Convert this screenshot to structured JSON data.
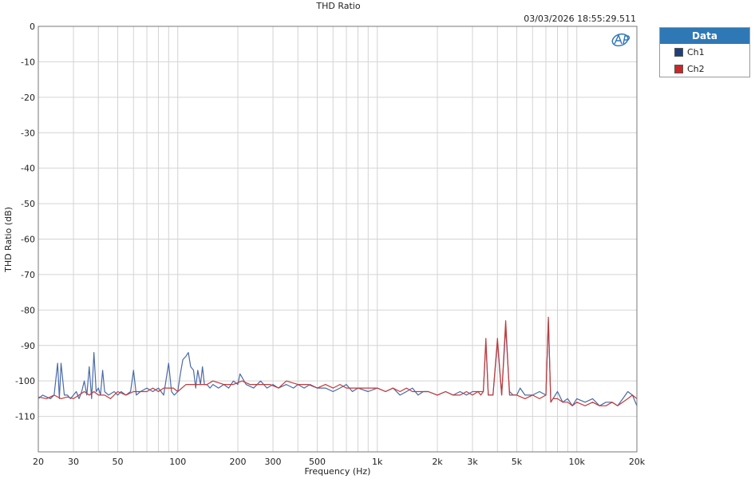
{
  "chart_data": {
    "type": "line",
    "title": "THD Ratio",
    "timestamp": "03/03/2026 18:55:29.511",
    "xlabel": "Frequency (Hz)",
    "ylabel": "THD Ratio (dB)",
    "xscale": "log",
    "xlim": [
      20,
      20000
    ],
    "ylim": [
      -120,
      0
    ],
    "grid": true,
    "x_ticks": [
      {
        "value": 20,
        "label": "20"
      },
      {
        "value": 30,
        "label": "30"
      },
      {
        "value": 50,
        "label": "50"
      },
      {
        "value": 100,
        "label": "100"
      },
      {
        "value": 200,
        "label": "200"
      },
      {
        "value": 300,
        "label": "300"
      },
      {
        "value": 500,
        "label": "500"
      },
      {
        "value": 1000,
        "label": "1k"
      },
      {
        "value": 2000,
        "label": "2k"
      },
      {
        "value": 3000,
        "label": "3k"
      },
      {
        "value": 5000,
        "label": "5k"
      },
      {
        "value": 10000,
        "label": "10k"
      },
      {
        "value": 20000,
        "label": "20k"
      }
    ],
    "y_ticks": [
      {
        "value": 0,
        "label": "0"
      },
      {
        "value": -10,
        "label": "-10"
      },
      {
        "value": -20,
        "label": "-20"
      },
      {
        "value": -30,
        "label": "-30"
      },
      {
        "value": -40,
        "label": "-40"
      },
      {
        "value": -50,
        "label": "-50"
      },
      {
        "value": -60,
        "label": "-60"
      },
      {
        "value": -70,
        "label": "-70"
      },
      {
        "value": -80,
        "label": "-80"
      },
      {
        "value": -90,
        "label": "-90"
      },
      {
        "value": -100,
        "label": "-100"
      },
      {
        "value": -110,
        "label": "-110"
      }
    ],
    "legend": {
      "title": "Data",
      "position": "right"
    },
    "series": [
      {
        "name": "Ch1",
        "color": "#4a6aa8",
        "points": [
          [
            20,
            -105
          ],
          [
            21,
            -104
          ],
          [
            22,
            -104.5
          ],
          [
            23,
            -105
          ],
          [
            24,
            -104
          ],
          [
            25,
            -95
          ],
          [
            25.5,
            -105
          ],
          [
            26,
            -95
          ],
          [
            27,
            -104
          ],
          [
            28,
            -104
          ],
          [
            29,
            -105
          ],
          [
            30,
            -104
          ],
          [
            31,
            -103
          ],
          [
            32,
            -105
          ],
          [
            33,
            -103
          ],
          [
            34,
            -100
          ],
          [
            35,
            -104
          ],
          [
            36,
            -96
          ],
          [
            37,
            -105
          ],
          [
            38,
            -92
          ],
          [
            39,
            -103
          ],
          [
            40,
            -102
          ],
          [
            41,
            -104
          ],
          [
            42,
            -97
          ],
          [
            43,
            -103
          ],
          [
            45,
            -104
          ],
          [
            48,
            -103
          ],
          [
            50,
            -104
          ],
          [
            52,
            -103
          ],
          [
            55,
            -104
          ],
          [
            58,
            -103
          ],
          [
            60,
            -97
          ],
          [
            62,
            -104
          ],
          [
            65,
            -103
          ],
          [
            70,
            -102
          ],
          [
            75,
            -103
          ],
          [
            80,
            -102
          ],
          [
            85,
            -104
          ],
          [
            90,
            -95
          ],
          [
            93,
            -103
          ],
          [
            96,
            -104
          ],
          [
            100,
            -103
          ],
          [
            103,
            -98
          ],
          [
            106,
            -94
          ],
          [
            110,
            -93
          ],
          [
            113,
            -92
          ],
          [
            116,
            -96
          ],
          [
            120,
            -97
          ],
          [
            123,
            -102
          ],
          [
            126,
            -97
          ],
          [
            130,
            -101
          ],
          [
            133,
            -96
          ],
          [
            136,
            -101
          ],
          [
            140,
            -101
          ],
          [
            145,
            -102
          ],
          [
            150,
            -101
          ],
          [
            160,
            -102
          ],
          [
            170,
            -101
          ],
          [
            180,
            -102
          ],
          [
            190,
            -100
          ],
          [
            200,
            -101
          ],
          [
            205,
            -98
          ],
          [
            210,
            -99
          ],
          [
            220,
            -101
          ],
          [
            240,
            -102
          ],
          [
            260,
            -100
          ],
          [
            280,
            -102
          ],
          [
            300,
            -101
          ],
          [
            320,
            -102
          ],
          [
            350,
            -101
          ],
          [
            380,
            -102
          ],
          [
            400,
            -101
          ],
          [
            430,
            -102
          ],
          [
            460,
            -101
          ],
          [
            500,
            -102
          ],
          [
            550,
            -102
          ],
          [
            600,
            -103
          ],
          [
            650,
            -102
          ],
          [
            700,
            -101
          ],
          [
            750,
            -103
          ],
          [
            800,
            -102
          ],
          [
            900,
            -103
          ],
          [
            1000,
            -102
          ],
          [
            1100,
            -103
          ],
          [
            1200,
            -102
          ],
          [
            1300,
            -104
          ],
          [
            1400,
            -103
          ],
          [
            1500,
            -102
          ],
          [
            1600,
            -104
          ],
          [
            1700,
            -103
          ],
          [
            1800,
            -103
          ],
          [
            2000,
            -104
          ],
          [
            2200,
            -103
          ],
          [
            2400,
            -104
          ],
          [
            2600,
            -103
          ],
          [
            2800,
            -104
          ],
          [
            3000,
            -103
          ],
          [
            3200,
            -103
          ],
          [
            3300,
            -103
          ],
          [
            3400,
            -103
          ],
          [
            3500,
            -89
          ],
          [
            3600,
            -104
          ],
          [
            3800,
            -104
          ],
          [
            4000,
            -89
          ],
          [
            4200,
            -104
          ],
          [
            4400,
            -85
          ],
          [
            4600,
            -103
          ],
          [
            4800,
            -104
          ],
          [
            5000,
            -104
          ],
          [
            5200,
            -102
          ],
          [
            5500,
            -104
          ],
          [
            6000,
            -104
          ],
          [
            6500,
            -103
          ],
          [
            7000,
            -104
          ],
          [
            7200,
            -83
          ],
          [
            7400,
            -106
          ],
          [
            7600,
            -105
          ],
          [
            8000,
            -103
          ],
          [
            8500,
            -106
          ],
          [
            9000,
            -105
          ],
          [
            9500,
            -107
          ],
          [
            10000,
            -105
          ],
          [
            11000,
            -106
          ],
          [
            12000,
            -105
          ],
          [
            13000,
            -107
          ],
          [
            14000,
            -106
          ],
          [
            15000,
            -106
          ],
          [
            16000,
            -107
          ],
          [
            17000,
            -105
          ],
          [
            18000,
            -103
          ],
          [
            19000,
            -104
          ],
          [
            20000,
            -107
          ]
        ]
      },
      {
        "name": "Ch2",
        "color": "#c23b3b",
        "points": [
          [
            20,
            -104.5
          ],
          [
            22,
            -105
          ],
          [
            24,
            -104
          ],
          [
            26,
            -105
          ],
          [
            28,
            -104.5
          ],
          [
            30,
            -105
          ],
          [
            32,
            -104
          ],
          [
            34,
            -103
          ],
          [
            36,
            -104
          ],
          [
            38,
            -103
          ],
          [
            40,
            -104
          ],
          [
            43,
            -104
          ],
          [
            46,
            -105
          ],
          [
            50,
            -103
          ],
          [
            55,
            -104
          ],
          [
            60,
            -103
          ],
          [
            65,
            -103
          ],
          [
            70,
            -103
          ],
          [
            75,
            -102
          ],
          [
            80,
            -103
          ],
          [
            85,
            -102
          ],
          [
            90,
            -102
          ],
          [
            95,
            -102
          ],
          [
            100,
            -103
          ],
          [
            110,
            -101
          ],
          [
            120,
            -101
          ],
          [
            130,
            -101
          ],
          [
            140,
            -101
          ],
          [
            150,
            -100
          ],
          [
            170,
            -101
          ],
          [
            190,
            -101
          ],
          [
            210,
            -100
          ],
          [
            230,
            -101
          ],
          [
            260,
            -101
          ],
          [
            290,
            -101
          ],
          [
            320,
            -102
          ],
          [
            350,
            -100
          ],
          [
            400,
            -101
          ],
          [
            450,
            -101
          ],
          [
            500,
            -102
          ],
          [
            550,
            -101
          ],
          [
            600,
            -102
          ],
          [
            650,
            -101
          ],
          [
            700,
            -102
          ],
          [
            800,
            -102
          ],
          [
            900,
            -102
          ],
          [
            1000,
            -102
          ],
          [
            1100,
            -103
          ],
          [
            1200,
            -102
          ],
          [
            1300,
            -103
          ],
          [
            1400,
            -102
          ],
          [
            1500,
            -103
          ],
          [
            1600,
            -103
          ],
          [
            1800,
            -103
          ],
          [
            2000,
            -104
          ],
          [
            2200,
            -103
          ],
          [
            2400,
            -104
          ],
          [
            2600,
            -104
          ],
          [
            2800,
            -103
          ],
          [
            3000,
            -104
          ],
          [
            3200,
            -103
          ],
          [
            3300,
            -104
          ],
          [
            3400,
            -103
          ],
          [
            3500,
            -88
          ],
          [
            3600,
            -104
          ],
          [
            3800,
            -104
          ],
          [
            4000,
            -88
          ],
          [
            4200,
            -104
          ],
          [
            4400,
            -83
          ],
          [
            4600,
            -104
          ],
          [
            4800,
            -104
          ],
          [
            5000,
            -104
          ],
          [
            5500,
            -105
          ],
          [
            6000,
            -104
          ],
          [
            6500,
            -105
          ],
          [
            7000,
            -104
          ],
          [
            7200,
            -82
          ],
          [
            7400,
            -106
          ],
          [
            7600,
            -105
          ],
          [
            8000,
            -105
          ],
          [
            8500,
            -106
          ],
          [
            9000,
            -106
          ],
          [
            9500,
            -107
          ],
          [
            10000,
            -106
          ],
          [
            11000,
            -107
          ],
          [
            12000,
            -106
          ],
          [
            13000,
            -107
          ],
          [
            14000,
            -107
          ],
          [
            15000,
            -106
          ],
          [
            16000,
            -107
          ],
          [
            17000,
            -106
          ],
          [
            18000,
            -105
          ],
          [
            19000,
            -104
          ],
          [
            20000,
            -105
          ]
        ]
      }
    ]
  }
}
